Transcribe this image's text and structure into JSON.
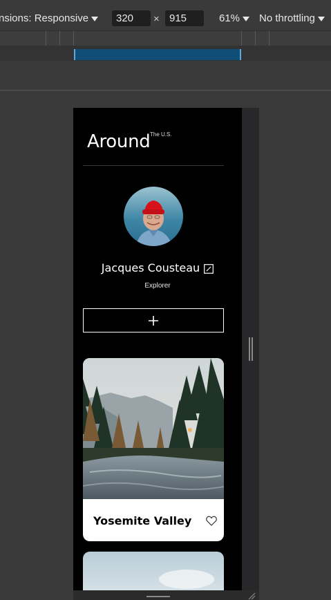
{
  "devtools": {
    "dimensions_label": "nsions: Responsive",
    "width": "320",
    "height": "915",
    "times": "×",
    "zoom": "61%",
    "throttling": "No throttling"
  },
  "page": {
    "brand": "Around",
    "brand_superscript": "The U.S.",
    "profile": {
      "name": "Jacques Cousteau",
      "role": "Explorer"
    },
    "add_button_symbol": "+",
    "cards": [
      {
        "title": "Yosemite Valley"
      }
    ]
  },
  "icons": [
    "caret-down-icon",
    "edit-icon",
    "plus-icon",
    "heart-icon"
  ],
  "colors": {
    "devtools_bg": "#3a3a3a",
    "ruler_active": "#104e78",
    "page_bg": "#000000",
    "card_bg": "#ffffff"
  }
}
